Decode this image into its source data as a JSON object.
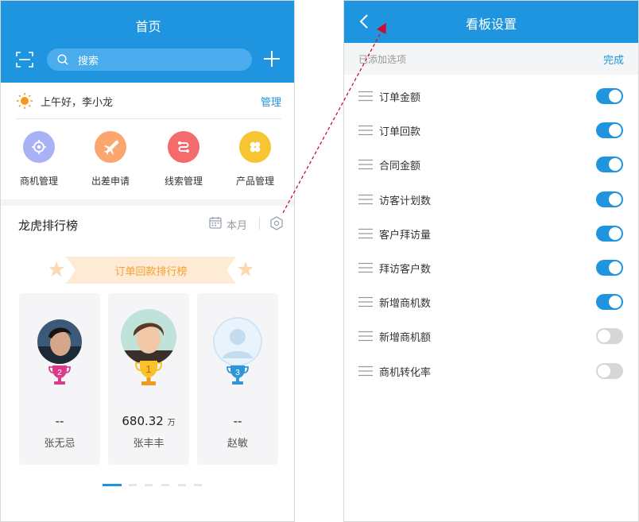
{
  "home": {
    "title": "首页",
    "search_placeholder": "搜索",
    "greeting": "上午好，李小龙",
    "manage_label": "管理",
    "apps": [
      {
        "label": "商机管理",
        "color": "#a9b2f5",
        "icon": "target-icon"
      },
      {
        "label": "出差申请",
        "color": "#fba56f",
        "icon": "plane-icon"
      },
      {
        "label": "线索管理",
        "color": "#f56a6a",
        "icon": "link-icon"
      },
      {
        "label": "产品管理",
        "color": "#f7c531",
        "icon": "clover-icon"
      }
    ],
    "ranking": {
      "title": "龙虎排行榜",
      "period": "本月",
      "banner": "订单回款排行榜",
      "cards": [
        {
          "rank": "2",
          "amount": "--",
          "unit": "",
          "name": "张无忌",
          "trophy_color": "#d93b8a"
        },
        {
          "rank": "1",
          "amount": "680.32",
          "unit": "万",
          "name": "张丰丰",
          "trophy_color": "#f8b32a"
        },
        {
          "rank": "3",
          "amount": "--",
          "unit": "",
          "name": "赵敏",
          "trophy_color": "#2e95d8"
        }
      ]
    }
  },
  "settings": {
    "title": "看板设置",
    "added_label": "已添加选项",
    "done_label": "完成",
    "items": [
      {
        "label": "订单金额",
        "on": true
      },
      {
        "label": "订单回款",
        "on": true
      },
      {
        "label": "合同金额",
        "on": true
      },
      {
        "label": "访客计划数",
        "on": true
      },
      {
        "label": "客户拜访量",
        "on": true
      },
      {
        "label": "拜访客户数",
        "on": true
      },
      {
        "label": "新增商机数",
        "on": true
      },
      {
        "label": "新增商机额",
        "on": false
      },
      {
        "label": "商机转化率",
        "on": false
      }
    ]
  },
  "colors": {
    "brand": "#1f94df",
    "toggle_off": "#d6d6d6",
    "banner_text": "#f5a02b",
    "arrow": "#c8102e"
  }
}
